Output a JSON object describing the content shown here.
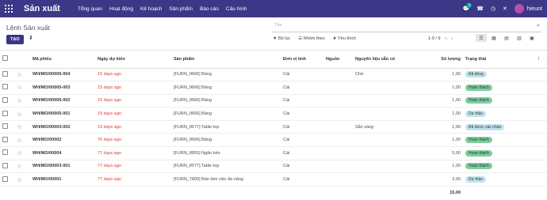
{
  "nav": {
    "app_name": "Sản xuất",
    "menu": [
      "Tổng quan",
      "Hoạt động",
      "Kế hoạch",
      "Sản phẩm",
      "Báo cáo",
      "Cấu hình"
    ],
    "message_count": "3",
    "user_name": "hieunt"
  },
  "control": {
    "title": "Lệnh Sản xuất",
    "search_placeholder": "Tìm",
    "create_label": "TẠO",
    "filter_label": "Bộ lọc",
    "group_label": "Nhóm theo",
    "favorite_label": "Yêu thích",
    "pager": "1-9 / 9"
  },
  "table": {
    "headers": [
      "Mã phiếu",
      "Ngày dự kiến",
      "Sản phẩm",
      "Đơn vị tính",
      "Nguồn",
      "Nguyên liệu sẵn có",
      "Số lượng",
      "Trạng thái"
    ],
    "rows": [
      {
        "code": "WH/MO/00005-004",
        "date": "15 days ago",
        "product": "[FURN_9666] Bảng",
        "uom": "Cái",
        "source": "",
        "avail": "Chờ",
        "qty": "1,00",
        "status": "Đã đóng"
      },
      {
        "code": "WH/MO/00005-003",
        "date": "15 days ago",
        "product": "[FURN_9666] Bảng",
        "uom": "Cái",
        "source": "",
        "avail": "",
        "qty": "1,00",
        "status": "Hoàn thành"
      },
      {
        "code": "WH/MO/00005-002",
        "date": "15 days ago",
        "product": "[FURN_9666] Bảng",
        "uom": "Cái",
        "source": "",
        "avail": "",
        "qty": "1,00",
        "status": "Hoàn thành"
      },
      {
        "code": "WH/MO/00005-001",
        "date": "15 days ago",
        "product": "[FURN_9666] Bảng",
        "uom": "Cái",
        "source": "",
        "avail": "",
        "qty": "1,00",
        "status": "Dự thảo"
      },
      {
        "code": "WH/MO/00003-002",
        "date": "19 days ago",
        "product": "[FURN_8577] Table top",
        "uom": "Cái",
        "source": "",
        "avail": "Sẵn sàng",
        "qty": "1,00",
        "status": "Đã được xác nhận"
      },
      {
        "code": "WH/MO/00002",
        "date": "76 days ago",
        "product": "[FURN_9666] Bảng",
        "uom": "Cái",
        "source": "",
        "avail": "",
        "qty": "1,00",
        "status": "Hoàn thành"
      },
      {
        "code": "WH/MO/00004",
        "date": "77 days ago",
        "product": "[FURN_8855] Ngăn kéo",
        "uom": "Cái",
        "source": "",
        "avail": "",
        "qty": "5,00",
        "status": "Hoàn thành"
      },
      {
        "code": "WH/MO/00003-001",
        "date": "77 days ago",
        "product": "[FURN_8577] Table top",
        "uom": "Cái",
        "source": "",
        "avail": "",
        "qty": "1,00",
        "status": "Hoàn thành"
      },
      {
        "code": "WH/MO/00001",
        "date": "77 days ago",
        "product": "[FURN_7800] Bàn làm việc đa năng",
        "uom": "Cái",
        "source": "",
        "avail": "",
        "qty": "3,00",
        "status": "Dự thảo"
      }
    ],
    "total_qty": "15,00"
  },
  "status_colors": {
    "Đã đóng": "blue",
    "Hoàn thành": "green",
    "Dự thảo": "blue",
    "Đã được xác nhận": "blue"
  }
}
